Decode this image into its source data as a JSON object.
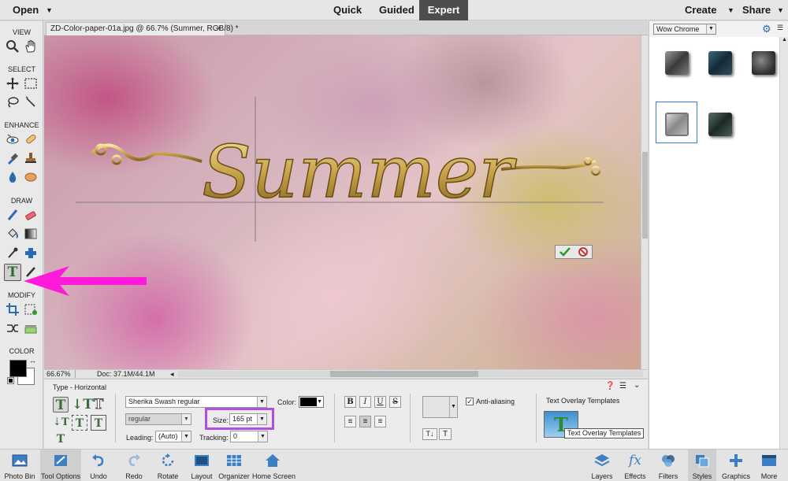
{
  "topbar": {
    "open_label": "Open",
    "modes": [
      "Quick",
      "Guided",
      "Expert"
    ],
    "active_mode": "Expert",
    "create_label": "Create",
    "share_label": "Share"
  },
  "toolbox": {
    "sections": [
      "VIEW",
      "SELECT",
      "ENHANCE",
      "DRAW",
      "MODIFY",
      "COLOR"
    ],
    "active_tool": "type-tool",
    "foreground_color": "#000000",
    "background_color": "#ffffff"
  },
  "document": {
    "tab_title": "ZD-Color-paper-01a.jpg @ 66.7% (Summer, RGB/8) *",
    "close_glyph": "×",
    "canvas_text": "Summer",
    "zoom": "66.67%",
    "doc_info": "Doc: 37.1M/44.1M"
  },
  "options": {
    "tool_name": "Type - Horizontal",
    "font_family": "Sherika Swash regular",
    "font_style": "regular",
    "color_label": "Color:",
    "size_label": "Size:",
    "size_value": "165 pt",
    "leading_label": "Leading:",
    "leading_value": "(Auto)",
    "tracking_label": "Tracking:",
    "tracking_value": "0",
    "bold": "B",
    "italic": "I",
    "underline": "U",
    "strike": "S",
    "anti_aliasing_label": "Anti-aliasing",
    "anti_aliasing_checked": true,
    "overlay_heading": "Text Overlay Templates",
    "overlay_tooltip": "Text Overlay Templates",
    "text_color": "#000000"
  },
  "right_panel": {
    "style_category": "Wow Chrome",
    "swatches": [
      {
        "name": "chrome-grey",
        "color": "#5a5a5a"
      },
      {
        "name": "chrome-teal",
        "color": "#1f3a4a"
      },
      {
        "name": "chrome-mottled",
        "color": "#4a4a4a"
      },
      {
        "name": "chrome-silver",
        "color": "#9a9a9a"
      },
      {
        "name": "chrome-dark-green",
        "color": "#3a4a48"
      }
    ],
    "selected_swatch": "chrome-silver"
  },
  "taskbar": {
    "left": [
      "Photo Bin",
      "Tool Options",
      "Undo",
      "Redo",
      "Rotate",
      "Layout",
      "Organizer",
      "Home Screen"
    ],
    "right": [
      "Layers",
      "Effects",
      "Filters",
      "Styles",
      "Graphics",
      "More"
    ]
  },
  "colors": {
    "accent_pink": "#ff1ad9",
    "size_highlight": "#b04ee8",
    "expert_tab_bg": "#4d4d4d",
    "commit_green": "#2e9a2e",
    "cancel_red": "#c62828"
  }
}
